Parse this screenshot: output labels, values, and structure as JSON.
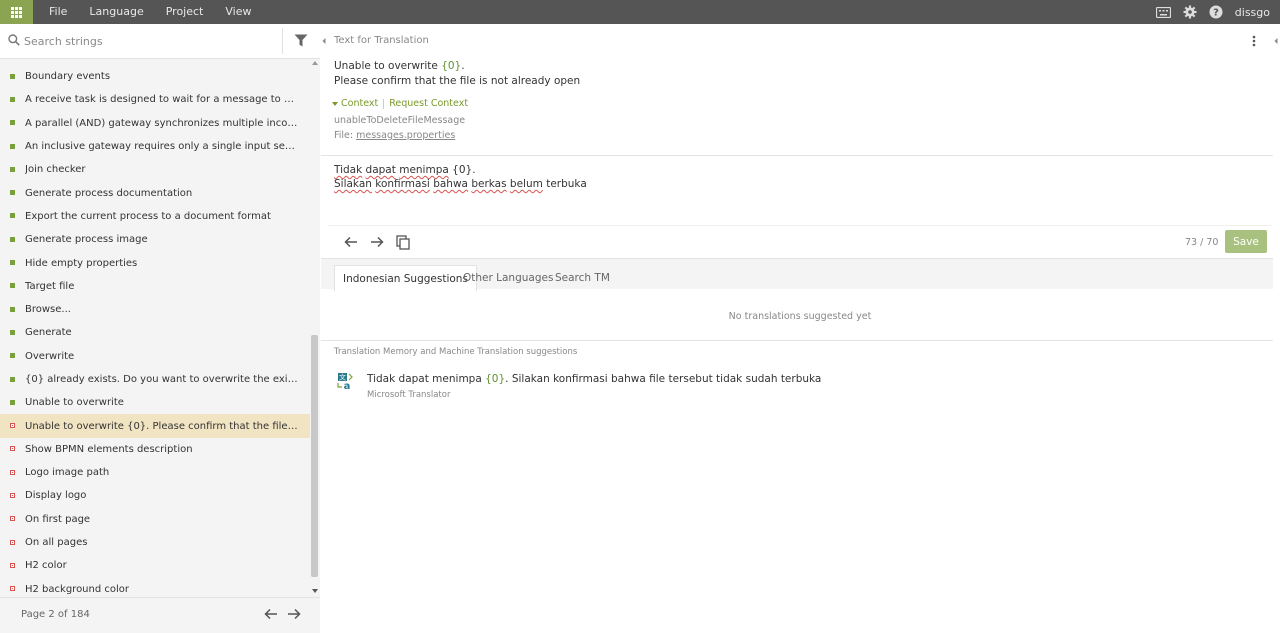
{
  "topbar": {
    "menu": [
      "File",
      "Language",
      "Project",
      "View"
    ],
    "user": "dissgo"
  },
  "left": {
    "search_placeholder": "Search strings",
    "items": [
      {
        "label": "Boundary events",
        "status": "ok"
      },
      {
        "label": "A receive task is designed to wait for a message to arrive from an ...",
        "status": "ok"
      },
      {
        "label": "A parallel (AND) gateway synchronizes multiple incoming flows: all ...",
        "status": "ok"
      },
      {
        "label": "An inclusive gateway requires only a single input sequence to activ...",
        "status": "ok"
      },
      {
        "label": "Join checker",
        "status": "ok"
      },
      {
        "label": "Generate process documentation",
        "status": "ok"
      },
      {
        "label": "Export the current process to a document format",
        "status": "ok"
      },
      {
        "label": "Generate process image",
        "status": "ok"
      },
      {
        "label": "Hide empty properties",
        "status": "ok"
      },
      {
        "label": "Target file",
        "status": "ok"
      },
      {
        "label": "Browse...",
        "status": "ok"
      },
      {
        "label": "Generate",
        "status": "ok"
      },
      {
        "label": "Overwrite",
        "status": "ok"
      },
      {
        "label": "{0} already exists. Do you want to overwrite the existing file?",
        "status": "ok"
      },
      {
        "label": "Unable to overwrite",
        "status": "ok"
      },
      {
        "label": "Unable to overwrite {0}. Please confirm that the file is not already ...",
        "status": "no",
        "selected": true
      },
      {
        "label": "Show BPMN elements description",
        "status": "no"
      },
      {
        "label": "Logo image path",
        "status": "no"
      },
      {
        "label": "Display logo",
        "status": "no"
      },
      {
        "label": "On first page",
        "status": "no"
      },
      {
        "label": "On all pages",
        "status": "no"
      },
      {
        "label": "H2 color",
        "status": "no"
      },
      {
        "label": "H2 background color",
        "status": "no"
      }
    ],
    "pager": {
      "label": "Page 2 of 184"
    }
  },
  "source": {
    "header": "Text for Translation",
    "line1_prefix": "Unable to overwrite ",
    "line1_token": "{0}",
    "line1_suffix": ".",
    "line2": "Please confirm that the file is not already open",
    "context_label": "Context",
    "request_context_label": "Request Context",
    "key": "unableToDeleteFileMessage",
    "file_prefix": "File: ",
    "file_name": "messages.properties"
  },
  "translation": {
    "w1": "Tidak",
    "w2": "dapat",
    "w3": "menimpa",
    "w4": "{0}.",
    "w5": "Silakan",
    "w6": "konfirmasi",
    "w7": "bahwa",
    "w8": "berkas",
    "w9": "belum",
    "w10": "terbuka",
    "counter": "73 / 70",
    "save_label": "Save"
  },
  "tabs": [
    "Indonesian Suggestions",
    "Other Languages",
    "Search TM"
  ],
  "suggestions": {
    "empty": "No translations suggested yet",
    "tm_header": "Translation Memory and Machine Translation suggestions",
    "mt_prefix": "Tidak dapat menimpa ",
    "mt_token": "{0}",
    "mt_suffix": ". Silakan konfirmasi bahwa file tersebut tidak sudah terbuka",
    "mt_source": "Microsoft Translator"
  },
  "colors": {
    "accent": "#8aa452",
    "save": "#a9c17e",
    "selected_row": "#f1e4c2",
    "topbar": "#555555"
  }
}
